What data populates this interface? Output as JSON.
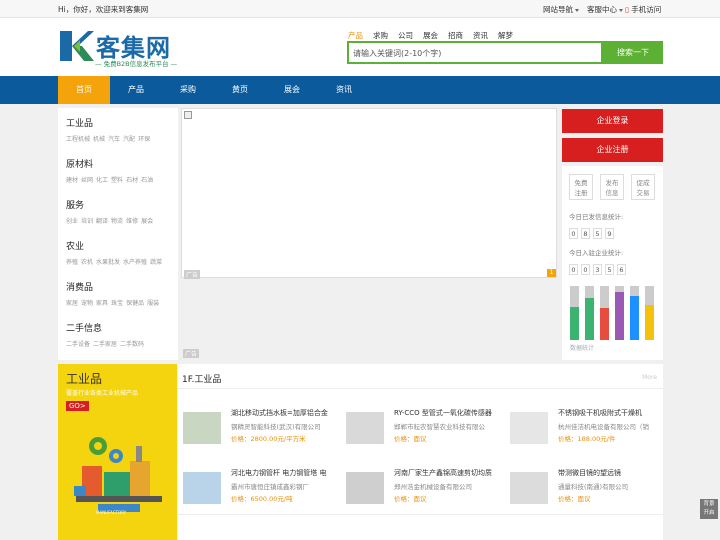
{
  "topbar": {
    "greeting": "Hi，你好，欢迎来到客集网",
    "site_nav": "网站导航",
    "service": "客服中心",
    "mobile": "手机访问"
  },
  "header": {
    "logo_text": "客集网",
    "slogan": "— 免费B2B信息发布平台 —",
    "search_tabs": [
      "产品",
      "求购",
      "公司",
      "展会",
      "招商",
      "资讯",
      "解梦"
    ],
    "search_placeholder": "请输入关键词(2-10个字)",
    "search_button": "搜索一下"
  },
  "nav": {
    "items": [
      "首页",
      "产品",
      "采购",
      "黄页",
      "展会",
      "资讯"
    ]
  },
  "categories": [
    {
      "title": "工业品",
      "subs": [
        "工程机械",
        "机械",
        "汽车",
        "汽配",
        "环保"
      ]
    },
    {
      "title": "原材料",
      "subs": [
        "建材",
        "丝网",
        "化工",
        "塑料",
        "石材",
        "石油"
      ]
    },
    {
      "title": "服务",
      "subs": [
        "创业",
        "培训",
        "翻译",
        "物流",
        "维修",
        "展会"
      ]
    },
    {
      "title": "农业",
      "subs": [
        "养殖",
        "农机",
        "水果批发",
        "水产养殖",
        "蔬菜"
      ]
    },
    {
      "title": "消费品",
      "subs": [
        "家居",
        "宠物",
        "家具",
        "珠宝",
        "保健品",
        "服装"
      ]
    },
    {
      "title": "二手信息",
      "subs": [
        "二手设备",
        "二手家居",
        "二手数码"
      ]
    }
  ],
  "banner": {
    "ad_label": "广告",
    "page_num": "1"
  },
  "right": {
    "login": "企业登录",
    "register": "企业注册",
    "quick": [
      {
        "l1": "免费",
        "l2": "注册"
      },
      {
        "l1": "发布",
        "l2": "信息"
      },
      {
        "l1": "促成",
        "l2": "交易"
      }
    ],
    "today_info_label": "今日已发信息统计:",
    "today_info_digits": [
      "0",
      "8",
      "5",
      "9"
    ],
    "today_company_label": "今日入驻企业统计:",
    "today_company_digits": [
      "0",
      "0",
      "3",
      "5",
      "6"
    ],
    "bars": [
      {
        "value": 0.62,
        "color": "#3cb371"
      },
      {
        "value": 0.78,
        "color": "#3cb371"
      },
      {
        "value": 0.6,
        "color": "#e84c3d"
      },
      {
        "value": 0.88,
        "color": "#9b59b6"
      },
      {
        "value": 0.82,
        "color": "#1e90ff"
      },
      {
        "value": 0.65,
        "color": "#f4c20d"
      }
    ],
    "bar_caption": "数据统计"
  },
  "floor1": {
    "promo_title": "工业品",
    "promo_sub": "覆盖行业各类工业机械产品",
    "promo_go": "GO>",
    "promo_label": "MANUFACTORY",
    "title": "1F.工业品",
    "more": "More",
    "products": [
      {
        "title": "湖北移动式挡水板=加厚铝合金",
        "company": "钢精灵智能科技(武汉)有限公司",
        "price": "价格：2800.00元/平方米"
      },
      {
        "title": "RY-CCO 型管式一氧化碳传感器",
        "company": "邯郸市耘农智慧农业科技有限公",
        "price": "价格：面议"
      },
      {
        "title": "不锈钢吸干机吸附式干燥机",
        "company": "杭州佳洁机电设备有限公司（销",
        "price": "价格：188.00元/件"
      },
      {
        "title": "河北电力钢管杆 电力钢管塔 电",
        "company": "霸州市唐恒庄镇成鑫彩钢厂",
        "price": "价格：6500.00元/吨"
      },
      {
        "title": "河南厂家生产鑫锦高速剪切均质",
        "company": "郑州浩金机械设备有限公司",
        "price": "价格：面议"
      },
      {
        "title": "带测微目镜的望远镜",
        "company": "通量科技(南通)有限公司",
        "price": "价格：面议"
      }
    ]
  },
  "backtop": {
    "l1": "背景",
    "l2": "开启"
  }
}
